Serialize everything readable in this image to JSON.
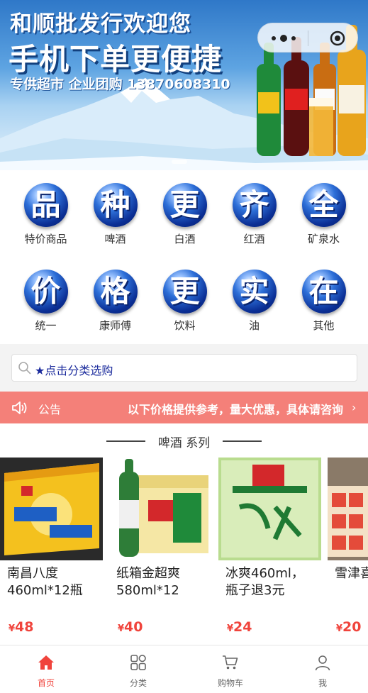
{
  "banner": {
    "line1": "和顺批发行欢迎您",
    "line2": "手机下单更便捷",
    "line3": "专供超市 企业团购 13870608310"
  },
  "categories": [
    {
      "glyph": "品",
      "label": "特价商品"
    },
    {
      "glyph": "种",
      "label": "啤酒"
    },
    {
      "glyph": "更",
      "label": "白酒"
    },
    {
      "glyph": "齐",
      "label": "红酒"
    },
    {
      "glyph": "全",
      "label": "矿泉水"
    },
    {
      "glyph": "价",
      "label": "统一"
    },
    {
      "glyph": "格",
      "label": "康师傅"
    },
    {
      "glyph": "更",
      "label": "饮料"
    },
    {
      "glyph": "实",
      "label": "油"
    },
    {
      "glyph": "在",
      "label": "其他"
    }
  ],
  "search": {
    "placeholder": "★点击分类选购"
  },
  "notice": {
    "title": "公告",
    "message": "以下价格提供参考，量大优惠，具体请咨询"
  },
  "section": {
    "title": "啤酒 系列"
  },
  "products": [
    {
      "name": "南昌八度460ml*12瓶",
      "currency": "¥",
      "price": "48"
    },
    {
      "name": "纸箱金超爽580ml*12",
      "currency": "¥",
      "price": "40"
    },
    {
      "name": "冰爽460ml，瓶子退3元",
      "currency": "¥",
      "price": "24"
    },
    {
      "name": "雪津喜ml",
      "currency": "¥",
      "price": "20"
    }
  ],
  "tabbar": [
    {
      "label": "首页",
      "icon": "home-icon"
    },
    {
      "label": "分类",
      "icon": "category-icon"
    },
    {
      "label": "购物车",
      "icon": "cart-icon"
    },
    {
      "label": "我",
      "icon": "user-icon"
    }
  ],
  "colors": {
    "accent": "#f0443c",
    "notice_bg": "#f48079",
    "ball": "#0b2f95"
  }
}
